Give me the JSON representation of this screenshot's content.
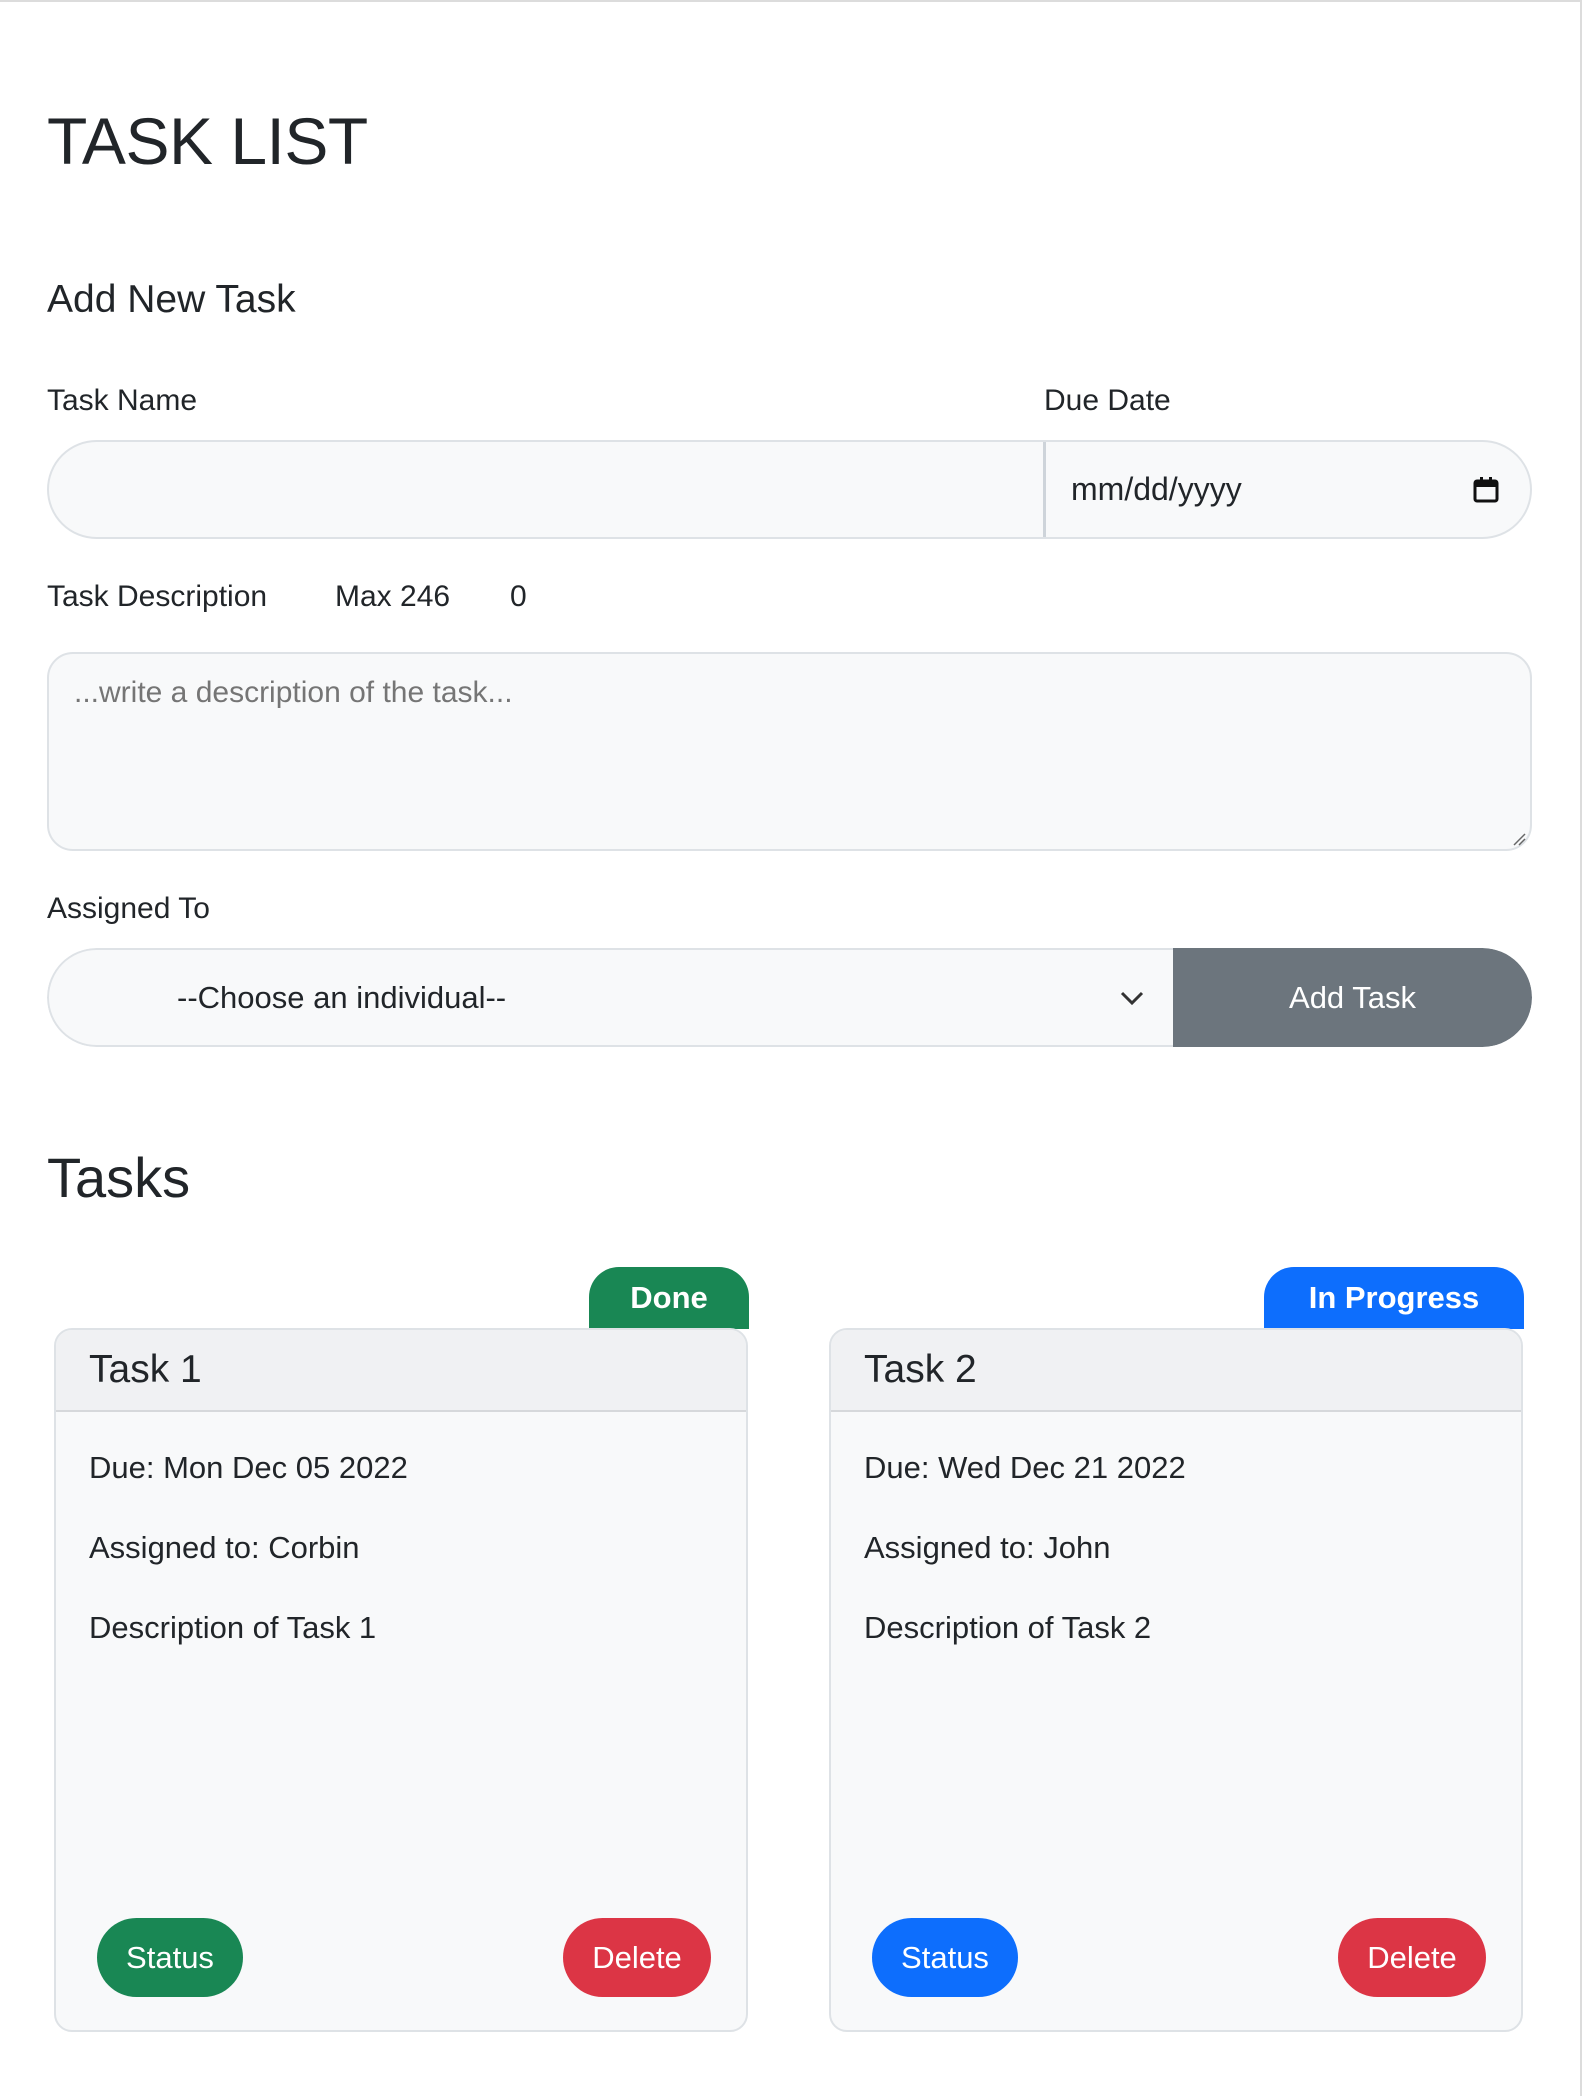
{
  "page": {
    "title": "TASK LIST",
    "form_title": "Add New Task",
    "tasks_title": "Tasks"
  },
  "form": {
    "task_name_label": "Task Name",
    "task_name_value": "",
    "due_date_label": "Due Date",
    "due_date_placeholder": "mm/dd/yyyy",
    "description_label": "Task Description",
    "max_label": "Max 246",
    "char_count": "0",
    "description_placeholder": "...write a description of the task...",
    "assigned_label": "Assigned To",
    "assigned_selected": "--Choose an individual--",
    "add_button": "Add Task"
  },
  "colors": {
    "done": "#198754",
    "in_progress": "#0d6efd",
    "delete": "#dc3545",
    "add_button": "#6c757d"
  },
  "tasks": [
    {
      "badge": "Done",
      "name": "Task 1",
      "due": "Due: Mon Dec 05 2022",
      "assigned": "Assigned to: Corbin",
      "description": "Description of Task 1",
      "status_button": "Status",
      "delete_button": "Delete"
    },
    {
      "badge": "In Progress",
      "name": "Task 2",
      "due": "Due: Wed Dec 21 2022",
      "assigned": "Assigned to: John",
      "description": "Description of Task 2",
      "status_button": "Status",
      "delete_button": "Delete"
    }
  ]
}
